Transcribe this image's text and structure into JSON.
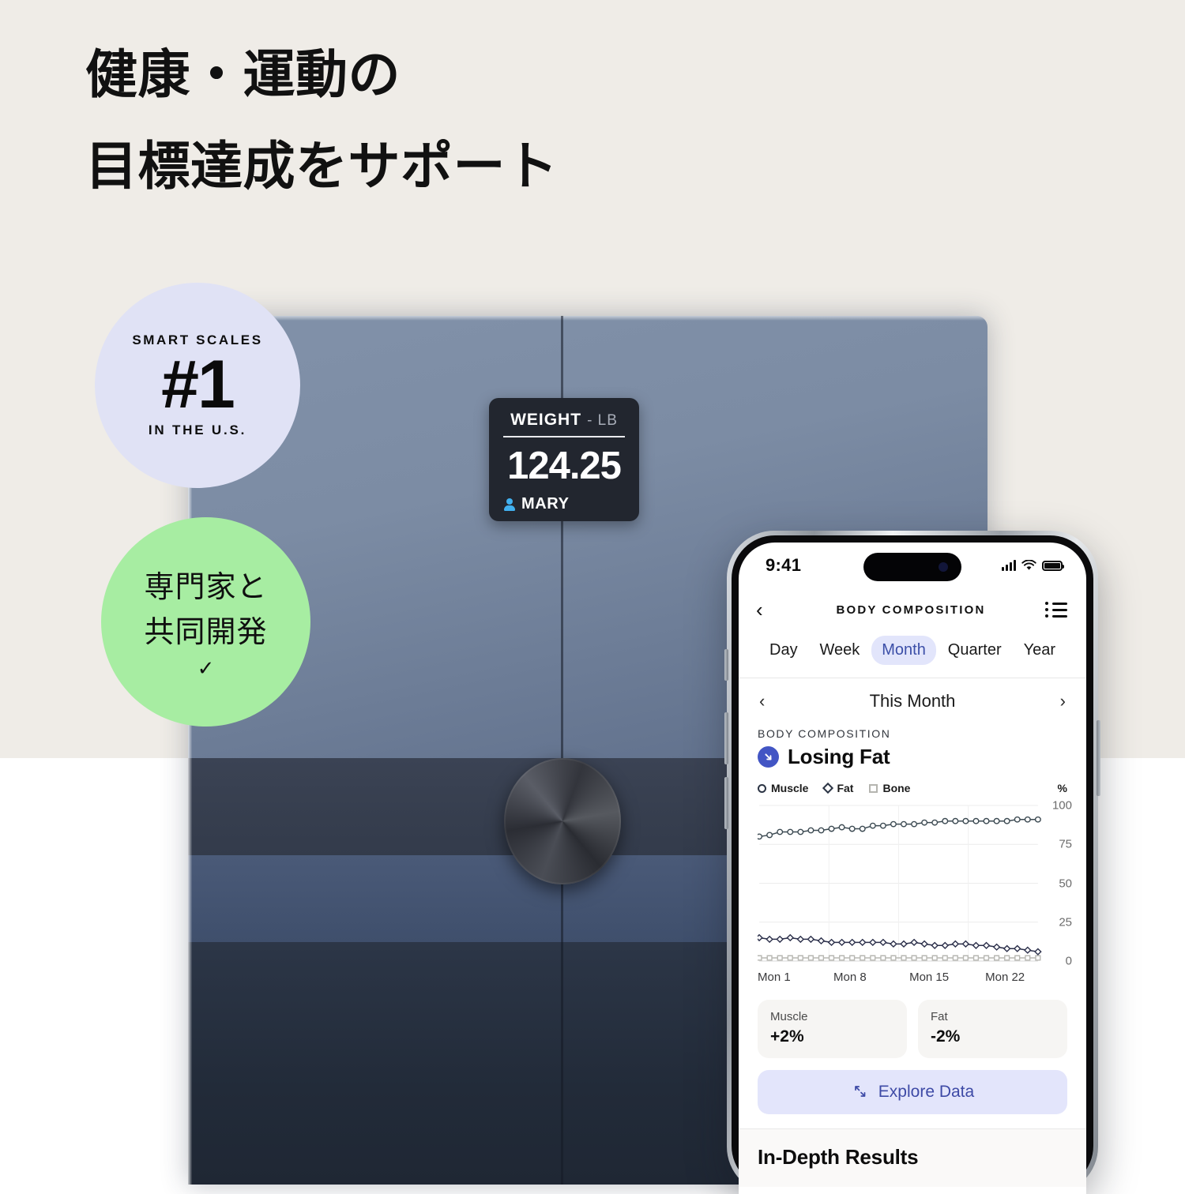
{
  "headline": {
    "line1": "健康・運動の",
    "line2": "目標達成をサポート"
  },
  "badges": {
    "rank": {
      "top": "SMART SCALES",
      "mid": "#1",
      "bottom": "IN THE U.S.",
      "color": "#e0e2f5"
    },
    "expert": {
      "line1": "専門家と",
      "line2": "共同開発",
      "check": "✓",
      "color": "#a7eda2"
    }
  },
  "scale": {
    "readout": {
      "metric": "WEIGHT",
      "unit": "- LB",
      "value": "124.25",
      "user": "MARY",
      "user_icon": "person-icon"
    }
  },
  "phone": {
    "status_bar": {
      "time": "9:41",
      "signal_icon": "cellular-signal-icon",
      "wifi_icon": "wifi-icon",
      "battery_icon": "battery-icon"
    },
    "nav": {
      "back_icon": "chevron-left-icon",
      "title": "BODY COMPOSITION",
      "list_icon": "list-icon"
    },
    "period_tabs": [
      {
        "label": "Day",
        "active": false
      },
      {
        "label": "Week",
        "active": false
      },
      {
        "label": "Month",
        "active": true
      },
      {
        "label": "Quarter",
        "active": false
      },
      {
        "label": "Year",
        "active": false
      }
    ],
    "period_accent": "#3c4fa8",
    "month_selector": {
      "prev_icon": "chevron-left-icon",
      "label": "This Month",
      "next_icon": "chevron-right-icon"
    },
    "body_composition": {
      "kicker": "BODY COMPOSITION",
      "status": "Losing Fat",
      "status_icon": "arrow-down-right-icon",
      "status_icon_color": "#4255c4"
    },
    "legend": [
      {
        "label": "Muscle",
        "marker": "circle-marker-icon",
        "color": "#2b3444"
      },
      {
        "label": "Fat",
        "marker": "diamond-marker-icon",
        "color": "#2b3444"
      },
      {
        "label": "Bone",
        "marker": "square-marker-icon",
        "color": "#b5b5b0"
      }
    ],
    "legend_unit": "%",
    "stats": [
      {
        "label": "Muscle",
        "value": "+2%"
      },
      {
        "label": "Fat",
        "value": "-2%"
      }
    ],
    "explore": {
      "label": "Explore Data",
      "icon": "expand-arrows-icon",
      "color": "#3e4aa6"
    },
    "in_depth": {
      "title": "In-Depth Results"
    }
  },
  "chart_data": {
    "type": "line",
    "title": "Body Composition",
    "xlabel": "",
    "ylabel": "%",
    "ylim": [
      0,
      100
    ],
    "yticks": [
      0,
      25,
      50,
      75,
      100
    ],
    "xticks": [
      "Mon 1",
      "Mon 8",
      "Mon 15",
      "Mon 22"
    ],
    "grid": true,
    "legend_position": "top-left",
    "x": [
      1,
      2,
      3,
      4,
      5,
      6,
      7,
      8,
      9,
      10,
      11,
      12,
      13,
      14,
      15,
      16,
      17,
      18,
      19,
      20,
      21,
      22,
      23,
      24,
      25,
      26,
      27,
      28
    ],
    "series": [
      {
        "name": "Muscle",
        "marker": "circle",
        "color": "#3c4a52",
        "values": [
          80,
          81,
          83,
          83,
          83,
          84,
          84,
          85,
          86,
          85,
          85,
          87,
          87,
          88,
          88,
          88,
          89,
          89,
          90,
          90,
          90,
          90,
          90,
          90,
          90,
          91,
          91,
          91
        ]
      },
      {
        "name": "Fat",
        "marker": "diamond",
        "color": "#2b2f4a",
        "values": [
          15,
          14,
          14,
          15,
          14,
          14,
          13,
          12,
          12,
          12,
          12,
          12,
          12,
          11,
          11,
          12,
          11,
          10,
          10,
          11,
          11,
          10,
          10,
          9,
          8,
          8,
          7,
          6
        ]
      },
      {
        "name": "Bone",
        "marker": "square",
        "color": "#b7b7b2",
        "values": [
          2,
          2,
          2,
          2,
          2,
          2,
          2,
          2,
          2,
          2,
          2,
          2,
          2,
          2,
          2,
          2,
          2,
          2,
          2,
          2,
          2,
          2,
          2,
          2,
          2,
          2,
          2,
          2
        ]
      }
    ]
  }
}
